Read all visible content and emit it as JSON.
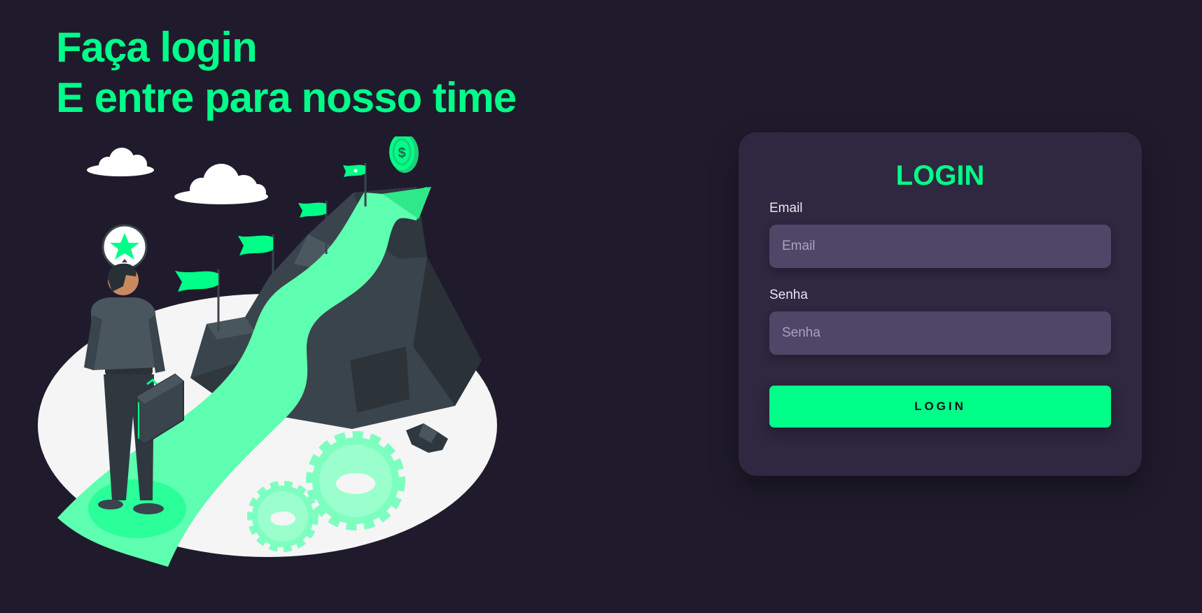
{
  "headline": {
    "line1": "Faça login",
    "line2": "E entre para nosso time"
  },
  "login_card": {
    "title": "LOGIN",
    "email": {
      "label": "Email",
      "placeholder": "Email",
      "value": ""
    },
    "password": {
      "label": "Senha",
      "placeholder": "Senha",
      "value": ""
    },
    "submit_label": "LOGIN"
  },
  "illustration": {
    "icons": [
      "cloud-icon",
      "star-badge-icon",
      "flag-icon",
      "dollar-coin-icon",
      "gear-icon",
      "mountain-icon",
      "person-icon",
      "briefcase-icon"
    ]
  },
  "colors": {
    "background": "#1f1b2c",
    "accent": "#00ff88",
    "card": "#2e2840",
    "input": "#4f4767",
    "ellipse": "#f5f5f5",
    "rock": "#37424a",
    "path": "#5effb0"
  }
}
